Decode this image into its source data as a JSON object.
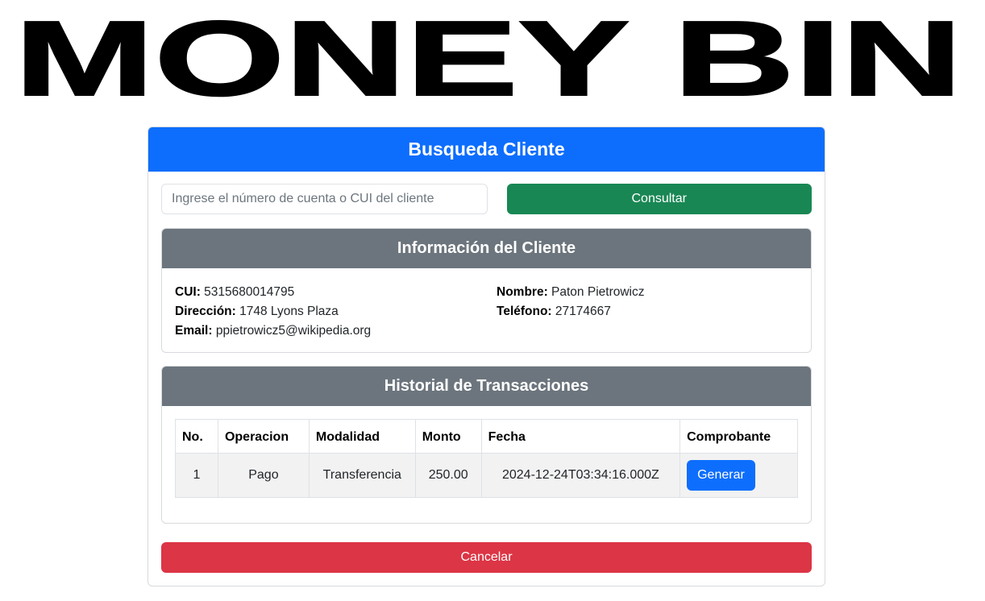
{
  "logo": {
    "text": "MONEY BIN"
  },
  "search_card": {
    "title": "Busqueda Cliente",
    "input_placeholder": "Ingrese el número de cuenta o CUI del cliente",
    "input_value": "",
    "consult_label": "Consultar"
  },
  "client_info": {
    "title": "Información del Cliente",
    "cui_label": "CUI:",
    "cui": "5315680014795",
    "address_label": "Dirección:",
    "address": "1748 Lyons Plaza",
    "email_label": "Email:",
    "email": "ppietrowicz5@wikipedia.org",
    "name_label": "Nombre:",
    "name": "Paton Pietrowicz",
    "phone_label": "Teléfono:",
    "phone": "27174667"
  },
  "history": {
    "title": "Historial de Transacciones",
    "columns": [
      "No.",
      "Operacion",
      "Modalidad",
      "Monto",
      "Fecha",
      "Comprobante"
    ],
    "rows": [
      {
        "no": "1",
        "operacion": "Pago",
        "modalidad": "Transferencia",
        "monto": "250.00",
        "fecha": "2024-12-24T03:34:16.000Z",
        "action_label": "Generar"
      }
    ]
  },
  "cancel_label": "Cancelar",
  "colors": {
    "primary": "#0d6efd",
    "success": "#198754",
    "secondary": "#6c757d",
    "danger": "#dc3545"
  }
}
